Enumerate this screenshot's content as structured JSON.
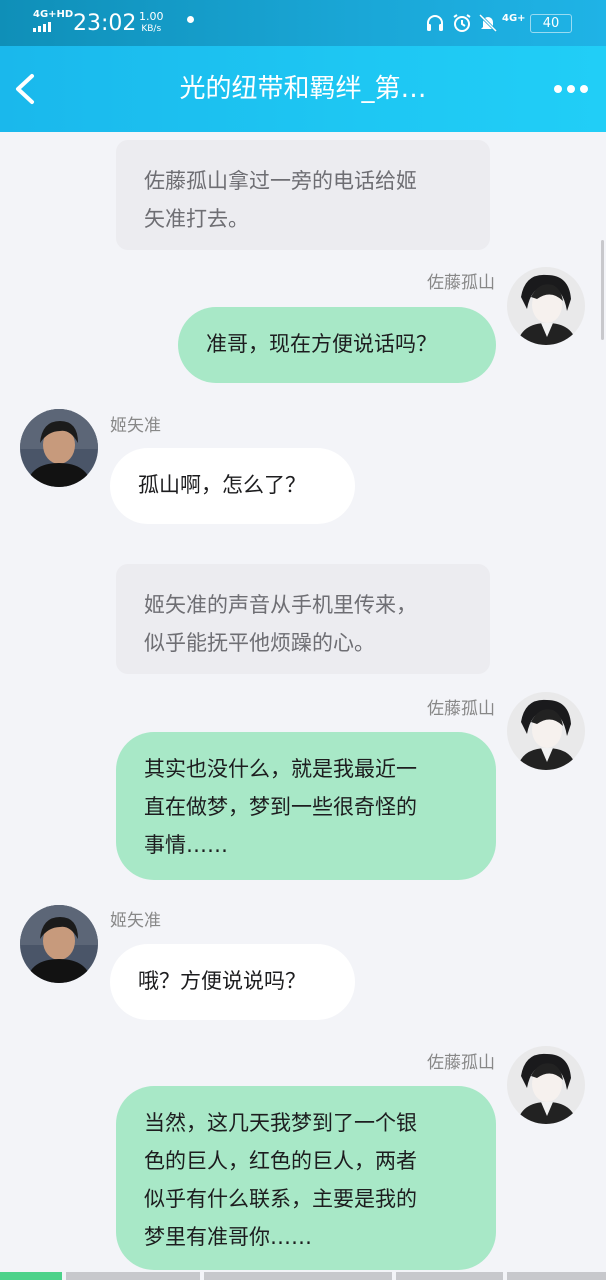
{
  "status_bar": {
    "network_left": "4G+HD",
    "time": "23:02",
    "speed_value": "1.00",
    "speed_unit": "KB/s",
    "network_right": "4G+",
    "battery": "40",
    "icons": [
      "headphones-icon",
      "alarm-icon",
      "mute-icon"
    ]
  },
  "header": {
    "title": "光的纽带和羁绊_第…",
    "back_icon": "chevron-left-icon",
    "more_icon": "more-dots-icon"
  },
  "messages": [
    {
      "type": "narration",
      "text_lines": [
        "佐藤孤山拿过一旁的电话给姬",
        "矢准打去。"
      ]
    },
    {
      "type": "right",
      "sender": "佐藤孤山",
      "text_lines": [
        "准哥，现在方便说话吗？"
      ]
    },
    {
      "type": "left",
      "sender": "姬矢准",
      "text_lines": [
        "孤山啊，怎么了？"
      ]
    },
    {
      "type": "narration",
      "text_lines": [
        "姬矢准的声音从手机里传来，",
        "似乎能抚平他烦躁的心。"
      ]
    },
    {
      "type": "right",
      "sender": "佐藤孤山",
      "text_lines": [
        "其实也没什么，就是我最近一",
        "直在做梦，梦到一些很奇怪的",
        "事情……"
      ]
    },
    {
      "type": "left",
      "sender": "姬矢准",
      "text_lines": [
        "哦？方便说说吗？"
      ]
    },
    {
      "type": "right",
      "sender": "佐藤孤山",
      "text_lines": [
        "当然，这几天我梦到了一个银",
        "色的巨人，红色的巨人，两者",
        "似乎有什么联系，主要是我的",
        "梦里有准哥你……"
      ]
    }
  ],
  "colors": {
    "header_bg": "#1ec7f3",
    "status_bg": "#1aa7d7",
    "bubble_right": "#a8e8c7",
    "bubble_left": "#ffffff",
    "narration_bg": "#ececf0",
    "page_bg": "#f3f4f8"
  },
  "bottom_progress": {
    "active_segments": 1,
    "total_segments": 5
  }
}
